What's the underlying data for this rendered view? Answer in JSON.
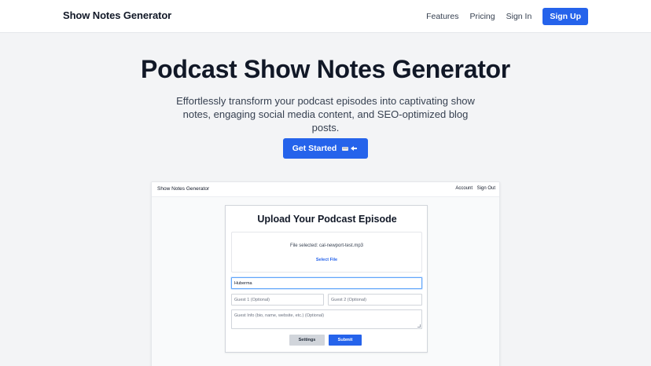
{
  "nav": {
    "brand": "Show Notes Generator",
    "links": [
      "Features",
      "Pricing",
      "Sign In"
    ],
    "signup": "Sign Up"
  },
  "hero": {
    "title": "Podcast Show Notes Generator",
    "subtitle": "Effortlessly transform your podcast episodes into captivating show notes, engaging social media content, and SEO-optimized blog posts.",
    "cta": "Get Started",
    "cta_icon": "pointing-hand-icon"
  },
  "app": {
    "brand": "Show Notes Generator",
    "account": "Account",
    "signout": "Sign Out",
    "card": {
      "title": "Upload Your Podcast Episode",
      "file_selected": "File selected: cal-newport-test.mp3",
      "select_file": "Select File",
      "host_value": "Huberma",
      "guest1_placeholder": "Guest 1 (Optional)",
      "guest2_placeholder": "Guest 2 (Optional)",
      "guest_info_placeholder": "Guest Info (bio, name, website, etc.) (Optional)",
      "settings": "Settings",
      "submit": "Submit"
    }
  },
  "colors": {
    "accent": "#2563eb",
    "background": "#f3f4f6",
    "text": "#111827"
  }
}
